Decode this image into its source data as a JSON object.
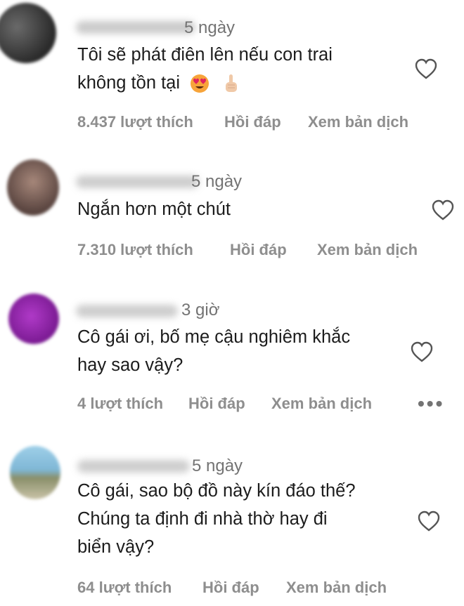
{
  "comments": [
    {
      "time": "5 ngày",
      "lines": [
        "Tôi sẽ phát điên lên nếu con trai",
        "không tồn tại"
      ],
      "emojis": [
        "smiling-face-with-heart-eyes",
        "index-pointing-up"
      ],
      "likes": "8.437 lượt thích",
      "reply": "Hồi đáp",
      "translate": "Xem bản dịch",
      "liked": false
    },
    {
      "time": "5 ngày",
      "lines": [
        "Ngắn hơn một chút"
      ],
      "likes": "7.310 lượt thích",
      "reply": "Hồi đáp",
      "translate": "Xem bản dịch",
      "liked": false
    },
    {
      "time": "3 giờ",
      "lines": [
        "Cô gái ơi, bố mẹ cậu nghiêm khắc",
        "hay sao vậy?"
      ],
      "likes": "4 lượt thích",
      "reply": "Hồi đáp",
      "translate": "Xem bản dịch",
      "more": "•••",
      "liked": false
    },
    {
      "time": "5 ngày",
      "lines": [
        "Cô gái, sao bộ đồ này kín đáo thế?",
        "Chúng ta định đi nhà thờ hay đi",
        "biển vậy?"
      ],
      "likes": "64 lượt thích",
      "reply": "Hồi đáp",
      "translate": "Xem bản dịch",
      "liked": false
    }
  ],
  "colors": {
    "text": "#1c1c1c",
    "secondary": "#8e8e8e",
    "background": "#ffffff"
  }
}
